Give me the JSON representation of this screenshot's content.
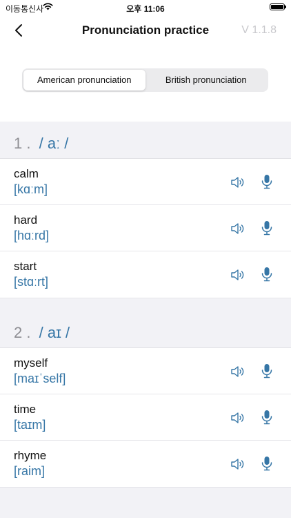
{
  "status_bar": {
    "carrier": "이동통신사",
    "time": "오후 11:06"
  },
  "nav": {
    "title": "Pronunciation practice",
    "version": "V 1.1.8"
  },
  "segments": [
    "American pronunciation",
    "British pronunciation"
  ],
  "sections": [
    {
      "number": "1",
      "phoneme": "/ aː /",
      "words": [
        {
          "word": "calm",
          "ipa": "[kɑːm]"
        },
        {
          "word": "hard",
          "ipa": "[hɑːrd]"
        },
        {
          "word": "start",
          "ipa": "[stɑːrt]"
        }
      ]
    },
    {
      "number": "2",
      "phoneme": "/ aɪ /",
      "words": [
        {
          "word": "myself",
          "ipa": "[maɪˈself]"
        },
        {
          "word": "time",
          "ipa": "[taɪm]"
        },
        {
          "word": "rhyme",
          "ipa": "[raim]"
        }
      ]
    }
  ]
}
